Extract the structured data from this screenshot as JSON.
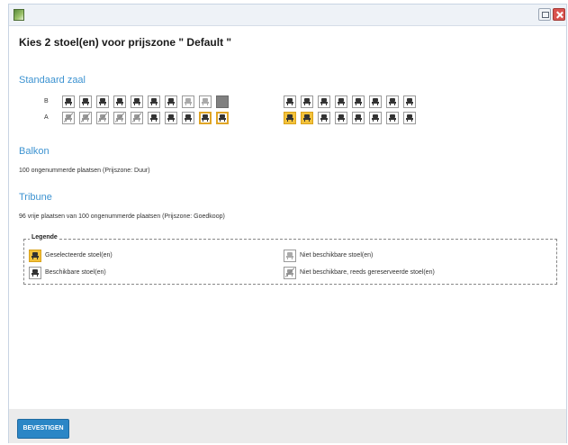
{
  "dialog": {
    "title": "Kies 2 stoel(en) voor prijszone \" Default \"",
    "icons": {
      "app": "app-icon",
      "restore": "restore-icon",
      "close": "close-icon"
    }
  },
  "sections": {
    "standaard_zaal": {
      "title": "Standaard zaal"
    },
    "balkon": {
      "title": "Balkon",
      "info": "100 ongenummerde plaatsen (Prijszone: Duur)"
    },
    "tribune": {
      "title": "Tribune",
      "info": "96 vrije plaatsen van 100 ongenummerde plaatsen (Prijszone: Goedkoop)"
    }
  },
  "seat_map": {
    "rows": [
      {
        "label": "B",
        "seats": [
          "available",
          "available",
          "available",
          "available",
          "available",
          "available",
          "available",
          "unavailable",
          "unavailable",
          "blocked",
          "available",
          "available",
          "available",
          "available",
          "available",
          "available",
          "available",
          "available"
        ]
      },
      {
        "label": "A",
        "seats": [
          "reserved",
          "reserved",
          "reserved",
          "reserved",
          "reserved",
          "available",
          "available",
          "available",
          "highlighted",
          "highlighted",
          "selected",
          "selected",
          "available",
          "available",
          "available",
          "available",
          "available",
          "available"
        ]
      }
    ]
  },
  "legend": {
    "title": "Legende",
    "items": [
      {
        "label": "Geselecteerde stoel(en)",
        "status": "selected"
      },
      {
        "label": "Beschikbare stoel(en)",
        "status": "available"
      },
      {
        "label": "Niet beschikbare stoel(en)",
        "status": "unavailable"
      },
      {
        "label": "Niet beschikbare, reeds gereserveerde stoel(en)",
        "status": "reserved"
      }
    ]
  },
  "footer": {
    "confirm_label": "BEVESTIGEN"
  },
  "colors": {
    "accent": "#3d93d1",
    "selected": "#f3c23b",
    "button": "#2b86c6"
  }
}
